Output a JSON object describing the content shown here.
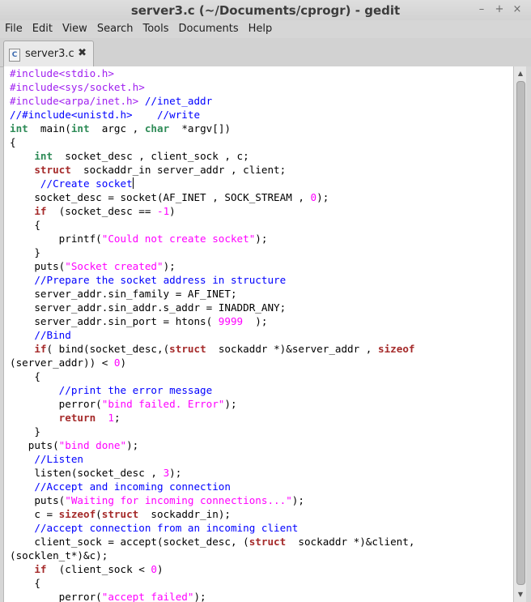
{
  "window": {
    "title": "server3.c (~/Documents/cprogr) - gedit",
    "minimize_glyph": "–",
    "maximize_glyph": "+",
    "close_glyph": "×"
  },
  "menu": [
    "File",
    "Edit",
    "View",
    "Search",
    "Tools",
    "Documents",
    "Help"
  ],
  "tab": {
    "label": "server3.c",
    "icon": "c-file-icon",
    "icon_text": "C",
    "close_glyph": "✖"
  },
  "scrollbar": {
    "position": 0.0,
    "visible_fraction": 0.94
  },
  "colors": {
    "preprocessor": "#a020f0",
    "comment": "#0000ff",
    "keyword": "#a52a2a",
    "type": "#2e8b57",
    "string": "#ff00ff",
    "number": "#ff00ff"
  },
  "code_lines": [
    [
      [
        "pp",
        "#include<stdio.h>"
      ]
    ],
    [
      [
        "pp",
        "#include<sys/socket.h>"
      ]
    ],
    [
      [
        "pp",
        "#include<arpa/inet.h> "
      ],
      [
        "cm",
        "//inet_addr"
      ]
    ],
    [
      [
        "cm",
        "//#include<unistd.h>    //write"
      ]
    ],
    [
      [
        "ty",
        "int"
      ],
      [
        "",
        "  main("
      ],
      [
        "ty",
        "int"
      ],
      [
        "",
        "  argc , "
      ],
      [
        "ty",
        "char"
      ],
      [
        "",
        "  *argv[])"
      ]
    ],
    [
      [
        "",
        "{"
      ]
    ],
    [
      [
        "",
        "    "
      ],
      [
        "ty",
        "int"
      ],
      [
        "",
        "  socket_desc , client_sock , c;"
      ]
    ],
    [
      [
        "",
        "    "
      ],
      [
        "kw",
        "struct"
      ],
      [
        "",
        "  sockaddr_in server_addr , client;"
      ]
    ],
    [
      [
        "",
        "     "
      ],
      [
        "cm",
        "//Create socket"
      ],
      [
        "caret",
        ""
      ]
    ],
    [
      [
        "",
        "    socket_desc = socket(AF_INET , SOCK_STREAM , "
      ],
      [
        "nm",
        "0"
      ],
      [
        "",
        ");"
      ]
    ],
    [
      [
        "",
        "    "
      ],
      [
        "kw",
        "if"
      ],
      [
        "",
        "  (socket_desc == "
      ],
      [
        "nm",
        "-1"
      ],
      [
        "",
        ")"
      ]
    ],
    [
      [
        "",
        "    {"
      ]
    ],
    [
      [
        "",
        "        printf("
      ],
      [
        "st",
        "\"Could not create socket\""
      ],
      [
        "",
        ");"
      ]
    ],
    [
      [
        "",
        "    }"
      ]
    ],
    [
      [
        "",
        "    puts("
      ],
      [
        "st",
        "\"Socket created\""
      ],
      [
        "",
        ");"
      ]
    ],
    [
      [
        "",
        "    "
      ],
      [
        "cm",
        "//Prepare the socket address in structure"
      ]
    ],
    [
      [
        "",
        "    server_addr.sin_family = AF_INET;"
      ]
    ],
    [
      [
        "",
        "    server_addr.sin_addr.s_addr = INADDR_ANY;"
      ]
    ],
    [
      [
        "",
        "    server_addr.sin_port = htons( "
      ],
      [
        "nm",
        "9999"
      ],
      [
        "",
        "  );"
      ]
    ],
    [
      [
        "",
        "    "
      ],
      [
        "cm",
        "//Bind"
      ]
    ],
    [
      [
        "",
        "    "
      ],
      [
        "kw",
        "if"
      ],
      [
        "",
        "( bind(socket_desc,("
      ],
      [
        "kw",
        "struct"
      ],
      [
        "",
        "  sockaddr *)&server_addr , "
      ],
      [
        "kw",
        "sizeof"
      ]
    ],
    [
      [
        "",
        "(server_addr)) < "
      ],
      [
        "nm",
        "0"
      ],
      [
        "",
        ")"
      ]
    ],
    [
      [
        "",
        "    {"
      ]
    ],
    [
      [
        "",
        "        "
      ],
      [
        "cm",
        "//print the error message"
      ]
    ],
    [
      [
        "",
        "        perror("
      ],
      [
        "st",
        "\"bind failed. Error\""
      ],
      [
        "",
        ");"
      ]
    ],
    [
      [
        "",
        "        "
      ],
      [
        "kw",
        "return"
      ],
      [
        "",
        "  "
      ],
      [
        "nm",
        "1"
      ],
      [
        "",
        ";"
      ]
    ],
    [
      [
        "",
        "    }"
      ]
    ],
    [
      [
        "",
        "   puts("
      ],
      [
        "st",
        "\"bind done\""
      ],
      [
        "",
        ");"
      ]
    ],
    [
      [
        "",
        "    "
      ],
      [
        "cm",
        "//Listen"
      ]
    ],
    [
      [
        "",
        "    listen(socket_desc , "
      ],
      [
        "nm",
        "3"
      ],
      [
        "",
        ");"
      ]
    ],
    [
      [
        "",
        "    "
      ],
      [
        "cm",
        "//Accept and incoming connection"
      ]
    ],
    [
      [
        "",
        "    puts("
      ],
      [
        "st",
        "\"Waiting for incoming connections...\""
      ],
      [
        "",
        ");"
      ]
    ],
    [
      [
        "",
        "    c = "
      ],
      [
        "kw",
        "sizeof"
      ],
      [
        "",
        "("
      ],
      [
        "kw",
        "struct"
      ],
      [
        "",
        "  sockaddr_in);"
      ]
    ],
    [
      [
        "",
        "    "
      ],
      [
        "cm",
        "//accept connection from an incoming client"
      ]
    ],
    [
      [
        "",
        "    client_sock = accept(socket_desc, ("
      ],
      [
        "kw",
        "struct"
      ],
      [
        "",
        "  sockaddr *)&client,"
      ]
    ],
    [
      [
        "",
        "(socklen_t*)&c);"
      ]
    ],
    [
      [
        "",
        "    "
      ],
      [
        "kw",
        "if"
      ],
      [
        "",
        "  (client_sock < "
      ],
      [
        "nm",
        "0"
      ],
      [
        "",
        ")"
      ]
    ],
    [
      [
        "",
        "    {"
      ]
    ],
    [
      [
        "",
        "        perror("
      ],
      [
        "st",
        "\"accept failed\""
      ],
      [
        "",
        ");"
      ]
    ]
  ]
}
